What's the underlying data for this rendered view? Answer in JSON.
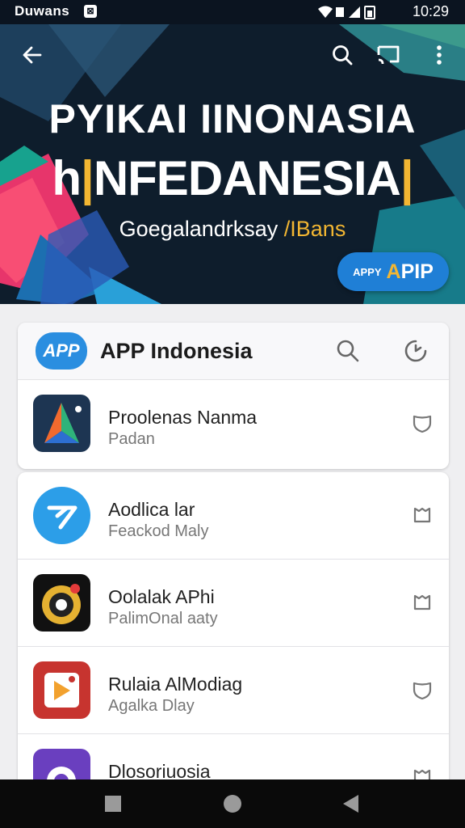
{
  "status_bar": {
    "carrier": "Duwans",
    "time": "10:29",
    "icons": [
      "notification-icon",
      "wifi-icon",
      "signal-icon",
      "battery-icon"
    ]
  },
  "hero": {
    "title_line1": "PYIKAI IINONASIA",
    "title_line2_pre": "h",
    "title_line2_main": "NFEDANESIA",
    "title_line2_end": "",
    "subtitle_main": "Goegalandrksay",
    "subtitle_accent": " /IBans",
    "badge_small": "APPY",
    "badge_big_accent": "A",
    "badge_big_rest": "PIP"
  },
  "header_card": {
    "logo_text": "APP",
    "title": "APP Indonesia"
  },
  "featured": {
    "name": "Proolenas Nanma",
    "sub": "Padan"
  },
  "apps": [
    {
      "name": "Aodlica lar",
      "sub": "Feackod Maly"
    },
    {
      "name": "Oolalak APhi",
      "sub": "PalimOnal aaty"
    },
    {
      "name": "Rulaia AlModiag",
      "sub": "Agalka Dlay"
    },
    {
      "name": "Dlosoriuosia",
      "sub": ""
    }
  ],
  "colors": {
    "accent": "#f2b632",
    "brand_blue": "#1f7fd6",
    "hero_bg": "#0f2030"
  }
}
